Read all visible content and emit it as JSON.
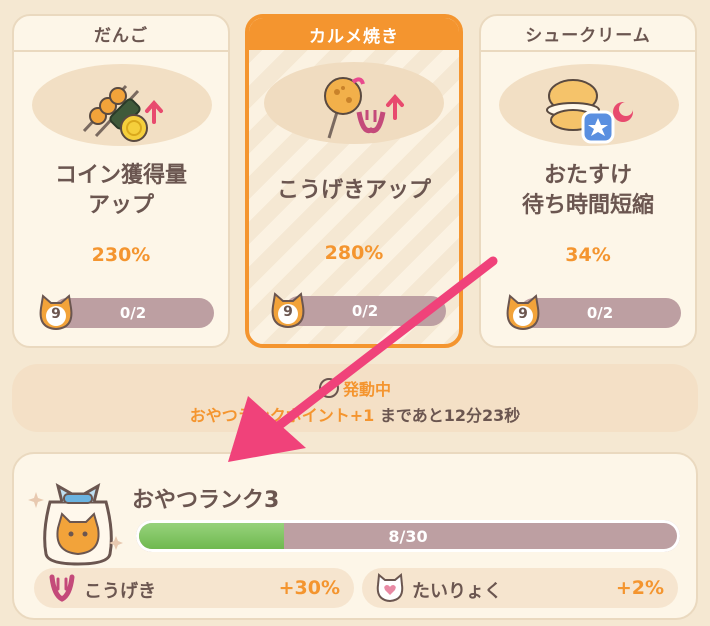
{
  "cards": [
    {
      "name": "だんご",
      "title": "コイン獲得量\nアップ",
      "value": "230%",
      "level": "9",
      "progress": "0/2",
      "selected": false
    },
    {
      "name": "カルメ焼き",
      "title": "こうげきアップ",
      "value": "280%",
      "level": "9",
      "progress": "0/2",
      "selected": true
    },
    {
      "name": "シュークリーム",
      "title": "おたすけ\n待ち時間短縮",
      "value": "34%",
      "level": "9",
      "progress": "0/2",
      "selected": false
    }
  ],
  "status": {
    "active_label": "発動中",
    "bonus_text": "おやつランクポイント+1",
    "remaining_text": "まであと12分23秒"
  },
  "rank": {
    "title": "おやつランク3",
    "progress_text": "8/30",
    "progress_value": 8,
    "progress_max": 30
  },
  "stats": [
    {
      "label": "こうげき",
      "value": "+30%",
      "icon": "claw-icon"
    },
    {
      "label": "たいりょく",
      "value": "+2%",
      "icon": "cat-heart-icon"
    }
  ],
  "colors": {
    "accent": "#f4952f",
    "text": "#6b5650",
    "bar": "#bd9fa2",
    "progress_fill": "#7cc15c",
    "arrow": "#f0427a",
    "background": "#f5e8d2"
  }
}
